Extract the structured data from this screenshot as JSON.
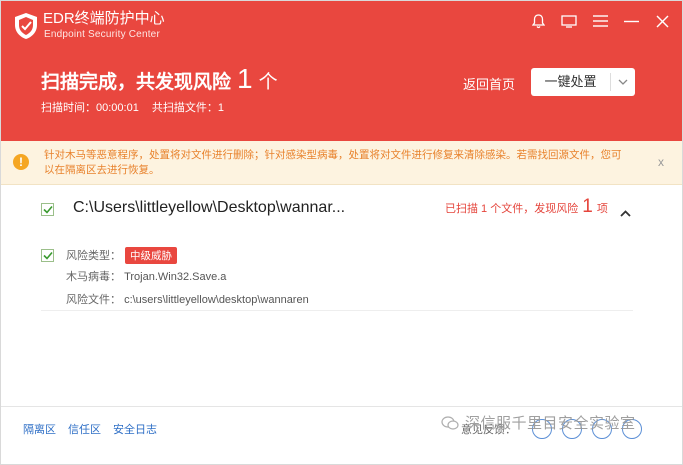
{
  "app": {
    "title": "EDR终端防护中心",
    "subtitle": "Endpoint Security Center"
  },
  "window_controls": [
    {
      "name": "bell-icon"
    },
    {
      "name": "message-icon"
    },
    {
      "name": "menu-icon"
    },
    {
      "name": "minimize-icon"
    },
    {
      "name": "close-icon"
    }
  ],
  "header": {
    "result_prefix": "扫描完成，共发现风险",
    "result_count": "1",
    "result_unit": "个",
    "scan_time_label": "扫描时间：00:00:01",
    "scan_files_label": "共扫描文件：1",
    "back_home": "返回首页",
    "onekey_label": "一键处置"
  },
  "notice": {
    "text": "针对木马等恶意程序，处置将对文件进行删除；针对感染型病毒，处置将对文件进行修复来清除感染。若需找回源文件，您可以在隔离区去进行恢复。",
    "close": "x"
  },
  "file": {
    "path": "C:\\Users\\littleyellow\\Desktop\\wannar...",
    "summary_prefix": "已扫描 1 个文件，发现风险",
    "summary_count": "1",
    "summary_unit": "项"
  },
  "detail": {
    "risk_type_key": "风险类型：",
    "risk_type_value": "中级威胁",
    "trojan_key": "木马病毒：",
    "trojan_value": "Trojan.Win32.Save.a",
    "risk_file_key": "风险文件：",
    "risk_file_value": "c:\\users\\littleyellow\\desktop\\wannaren"
  },
  "footer": {
    "links": [
      "隔离区",
      "信任区",
      "安全日志"
    ],
    "watermark": "深信服千里目安全实验室",
    "tray_label": "意见反馈："
  },
  "colors": {
    "header_bg": "#e9473f",
    "notice_bg": "#fdf3e0",
    "notice_text": "#e8822c",
    "link": "#2f6fc6"
  }
}
